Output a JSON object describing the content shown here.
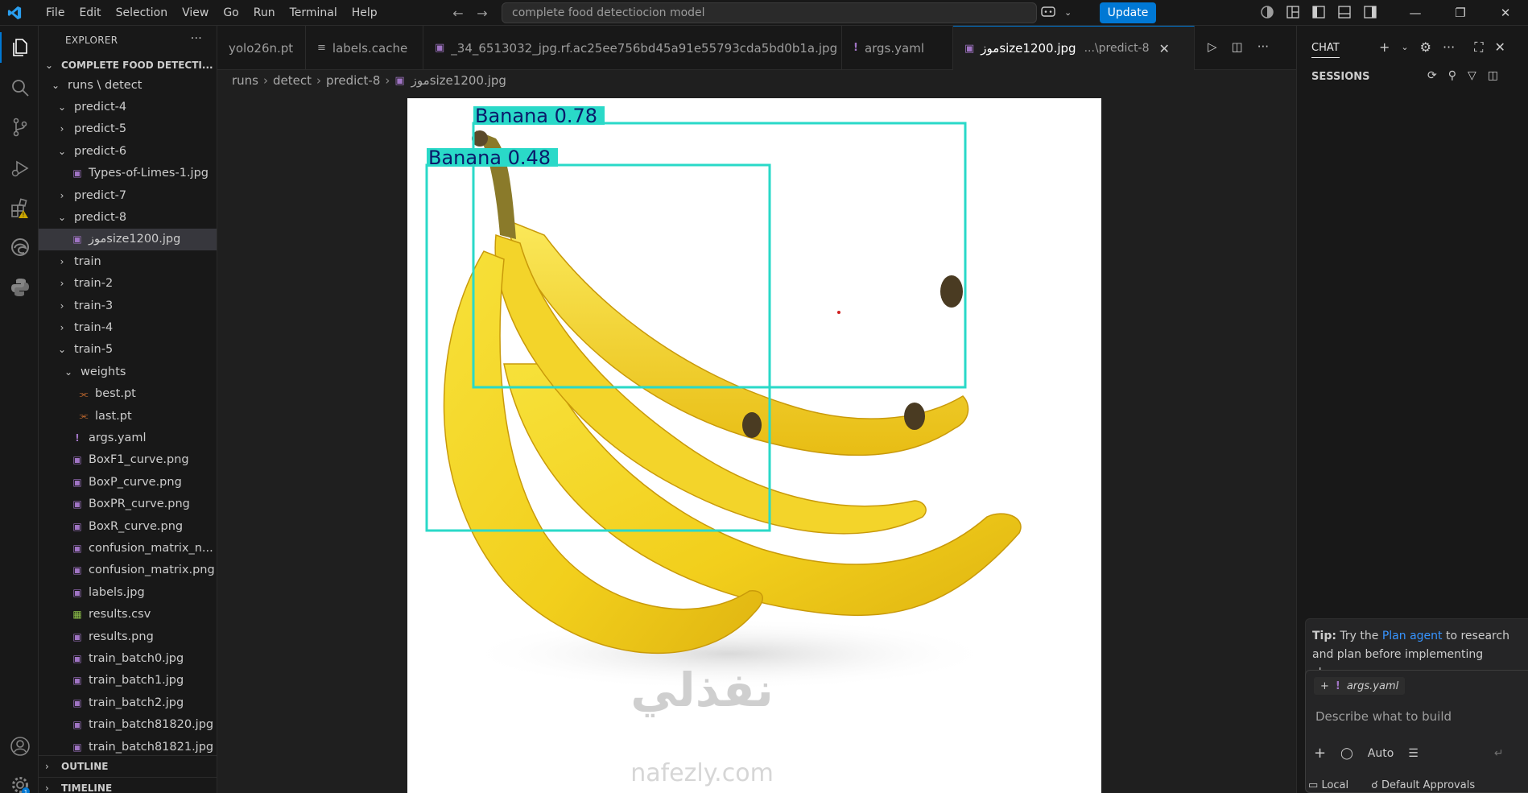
{
  "menu": [
    "File",
    "Edit",
    "Selection",
    "View",
    "Go",
    "Run",
    "Terminal",
    "Help"
  ],
  "command_center": {
    "query": "complete food detectiocion model"
  },
  "update_button": "Update",
  "explorer": {
    "title": "EXPLORER",
    "more": "···",
    "project": "COMPLETE FOOD DETECTI...",
    "tree": [
      {
        "label": "runs \\ detect",
        "depth": 0,
        "kind": "folder-open"
      },
      {
        "label": "predict-4",
        "depth": 1,
        "kind": "folder-open"
      },
      {
        "label": "predict-5",
        "depth": 1,
        "kind": "folder"
      },
      {
        "label": "predict-6",
        "depth": 1,
        "kind": "folder-open"
      },
      {
        "label": "Types-of-Limes-1.jpg",
        "depth": 2,
        "kind": "image"
      },
      {
        "label": "predict-7",
        "depth": 1,
        "kind": "folder"
      },
      {
        "label": "predict-8",
        "depth": 1,
        "kind": "folder-open"
      },
      {
        "label": "موزsize1200.jpg",
        "depth": 2,
        "kind": "image",
        "selected": true
      },
      {
        "label": "train",
        "depth": 1,
        "kind": "folder"
      },
      {
        "label": "train-2",
        "depth": 1,
        "kind": "folder"
      },
      {
        "label": "train-3",
        "depth": 1,
        "kind": "folder"
      },
      {
        "label": "train-4",
        "depth": 1,
        "kind": "folder"
      },
      {
        "label": "train-5",
        "depth": 1,
        "kind": "folder-open"
      },
      {
        "label": "weights",
        "depth": 2,
        "kind": "folder-open"
      },
      {
        "label": "best.pt",
        "depth": 3,
        "kind": "rss"
      },
      {
        "label": "last.pt",
        "depth": 3,
        "kind": "rss"
      },
      {
        "label": "args.yaml",
        "depth": 2,
        "kind": "yaml"
      },
      {
        "label": "BoxF1_curve.png",
        "depth": 2,
        "kind": "image"
      },
      {
        "label": "BoxP_curve.png",
        "depth": 2,
        "kind": "image"
      },
      {
        "label": "BoxPR_curve.png",
        "depth": 2,
        "kind": "image"
      },
      {
        "label": "BoxR_curve.png",
        "depth": 2,
        "kind": "image"
      },
      {
        "label": "confusion_matrix_n...",
        "depth": 2,
        "kind": "image"
      },
      {
        "label": "confusion_matrix.png",
        "depth": 2,
        "kind": "image"
      },
      {
        "label": "labels.jpg",
        "depth": 2,
        "kind": "image"
      },
      {
        "label": "results.csv",
        "depth": 2,
        "kind": "csv"
      },
      {
        "label": "results.png",
        "depth": 2,
        "kind": "image"
      },
      {
        "label": "train_batch0.jpg",
        "depth": 2,
        "kind": "image"
      },
      {
        "label": "train_batch1.jpg",
        "depth": 2,
        "kind": "image"
      },
      {
        "label": "train_batch2.jpg",
        "depth": 2,
        "kind": "image"
      },
      {
        "label": "train_batch81820.jpg",
        "depth": 2,
        "kind": "image"
      },
      {
        "label": "train_batch81821.jpg",
        "depth": 2,
        "kind": "image"
      }
    ],
    "outline": "OUTLINE",
    "timeline": "TIMELINE"
  },
  "tabs": [
    {
      "label": "yolo26n.pt",
      "icon": "none"
    },
    {
      "label": "labels.cache",
      "icon": "lines"
    },
    {
      "label": "_34_6513032_jpg.rf.ac25ee756bd45a91e55793cda5bd0b1a.jpg",
      "icon": "image"
    },
    {
      "label": "args.yaml",
      "icon": "yaml"
    },
    {
      "label": "موزsize1200.jpg",
      "icon": "image",
      "description": "...\\predict-8",
      "active": true
    }
  ],
  "breadcrumb": [
    "runs",
    "detect",
    "predict-8",
    "موزsize1200.jpg"
  ],
  "detections": [
    {
      "label": "Banana  0.78"
    },
    {
      "label": "Banana  0.48"
    }
  ],
  "watermark": {
    "arabic": "نفذلي",
    "latin": "nafezly.com"
  },
  "chat": {
    "title": "CHAT",
    "sessions": "SESSIONS",
    "tip_prefix": "Tip:",
    "tip_before": " Try the ",
    "tip_link": "Plan agent",
    "tip_after": " to research and plan before implementing changes.",
    "context_chip": "args.yaml",
    "placeholder": "Describe what to build",
    "mode": "Auto",
    "footer_local": "Local",
    "footer_approvals": "Default Approvals"
  },
  "accent_color": "#0078d4",
  "box_color": "#2ad9c8"
}
